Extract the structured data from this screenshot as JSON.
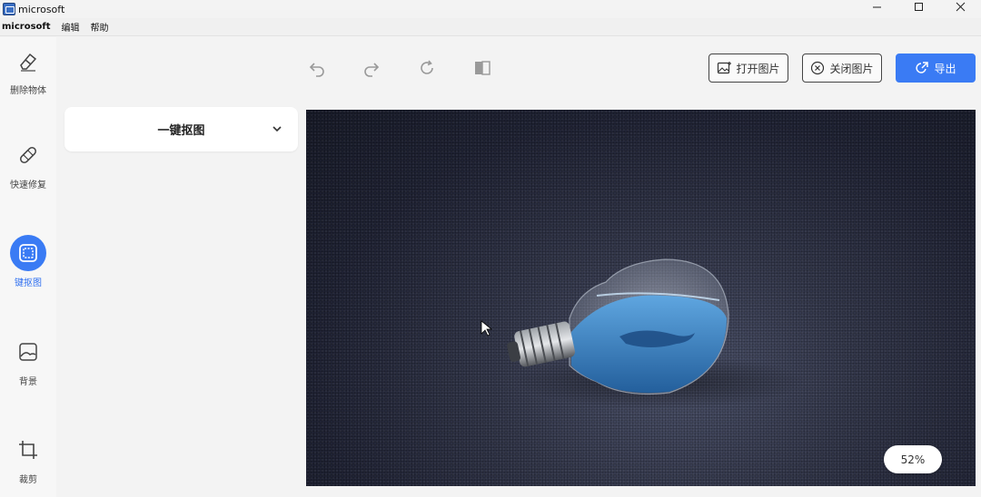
{
  "window": {
    "title": "microsoft"
  },
  "menu": {
    "items": [
      "microsoft",
      "编辑",
      "帮助"
    ]
  },
  "sidebar": {
    "items": [
      {
        "label": "删除物体",
        "icon": "eraser-icon"
      },
      {
        "label": "快速修复",
        "icon": "bandage-icon"
      },
      {
        "label": "键抠图",
        "icon": "cutout-icon",
        "active": true
      },
      {
        "label": "背景",
        "icon": "image-icon"
      },
      {
        "label": "裁剪",
        "icon": "crop-icon"
      }
    ]
  },
  "toolbar": {
    "undo_icon": "undo-icon",
    "redo_icon": "redo-icon",
    "reset_icon": "refresh-icon",
    "compare_icon": "compare-icon",
    "open_label": "打开图片",
    "close_label": "关闭图片",
    "export_label": "导出"
  },
  "panel": {
    "title": "一键抠图"
  },
  "canvas": {
    "zoom": "52%"
  },
  "colors": {
    "accent": "#3a7bf4"
  }
}
